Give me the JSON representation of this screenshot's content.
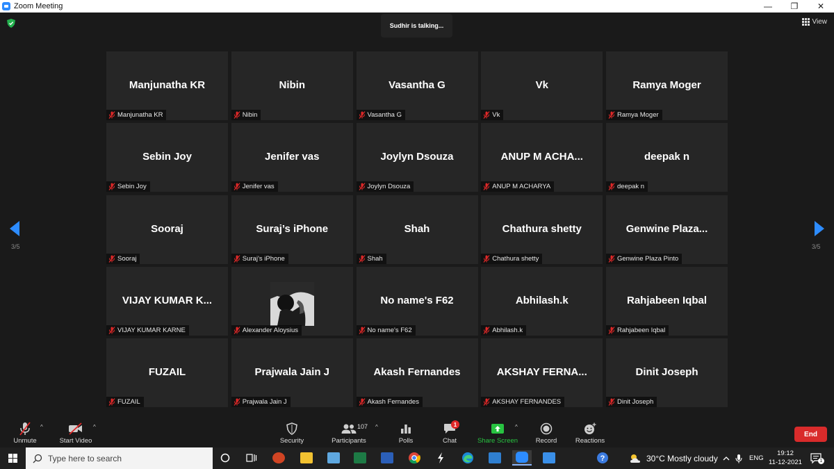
{
  "window": {
    "title": "Zoom Meeting",
    "minimize": "—",
    "restore": "❐",
    "close": "✕"
  },
  "meeting": {
    "talking_indicator": "Sudhir is talking...",
    "view_label": "View",
    "page_indicator": "3/5",
    "accent_color": "#2d8cff"
  },
  "participants": [
    {
      "big": "Manjunatha KR",
      "tag": "Manjunatha KR"
    },
    {
      "big": "Nibin",
      "tag": "Nibin"
    },
    {
      "big": "Vasantha G",
      "tag": "Vasantha G"
    },
    {
      "big": "Vk",
      "tag": "Vk"
    },
    {
      "big": "Ramya Moger",
      "tag": "Ramya Moger"
    },
    {
      "big": "Sebin Joy",
      "tag": "Sebin Joy"
    },
    {
      "big": "Jenifer vas",
      "tag": "Jenifer vas"
    },
    {
      "big": "Joylyn Dsouza",
      "tag": "Joylyn Dsouza"
    },
    {
      "big": "ANUP  M  ACHA...",
      "tag": "ANUP M ACHARYA"
    },
    {
      "big": "deepak n",
      "tag": "deepak n"
    },
    {
      "big": "Sooraj",
      "tag": "Sooraj"
    },
    {
      "big": "Suraj’s iPhone",
      "tag": "Suraj’s iPhone"
    },
    {
      "big": "Shah",
      "tag": "Shah"
    },
    {
      "big": "Chathura shetty",
      "tag": "Chathura shetty"
    },
    {
      "big": "Genwine  Plaza...",
      "tag": "Genwine Plaza Pinto"
    },
    {
      "big": "VIJAY  KUMAR  K...",
      "tag": "VIJAY KUMAR KARNE"
    },
    {
      "big": "",
      "tag": "Alexander Aloysius",
      "has_photo": true
    },
    {
      "big": "No name's F62",
      "tag": "No name's F62"
    },
    {
      "big": "Abhilash.k",
      "tag": "Abhilash.k"
    },
    {
      "big": "Rahjabeen Iqbal",
      "tag": "Rahjabeen Iqbal"
    },
    {
      "big": "FUZAIL",
      "tag": "FUZAIL"
    },
    {
      "big": "Prajwala Jain J",
      "tag": "Prajwala Jain J"
    },
    {
      "big": "Akash Fernandes",
      "tag": "Akash Fernandes"
    },
    {
      "big": "AKSHAY  FERNA...",
      "tag": "AKSHAY FERNANDES"
    },
    {
      "big": "Dinit Joseph",
      "tag": "Dinit Joseph"
    }
  ],
  "toolbar": {
    "unmute": "Unmute",
    "start_video": "Start Video",
    "security": "Security",
    "participants": "Participants",
    "participants_count": "107",
    "polls": "Polls",
    "chat": "Chat",
    "chat_badge": "1",
    "share_screen": "Share Screen",
    "record": "Record",
    "reactions": "Reactions",
    "end": "End",
    "caret": "^"
  },
  "taskbar": {
    "search_placeholder": "Type here to search",
    "weather": "30°C  Mostly cloudy",
    "language": "ENG",
    "time": "19:12",
    "date": "11-12-2021",
    "notification_count": "1"
  }
}
